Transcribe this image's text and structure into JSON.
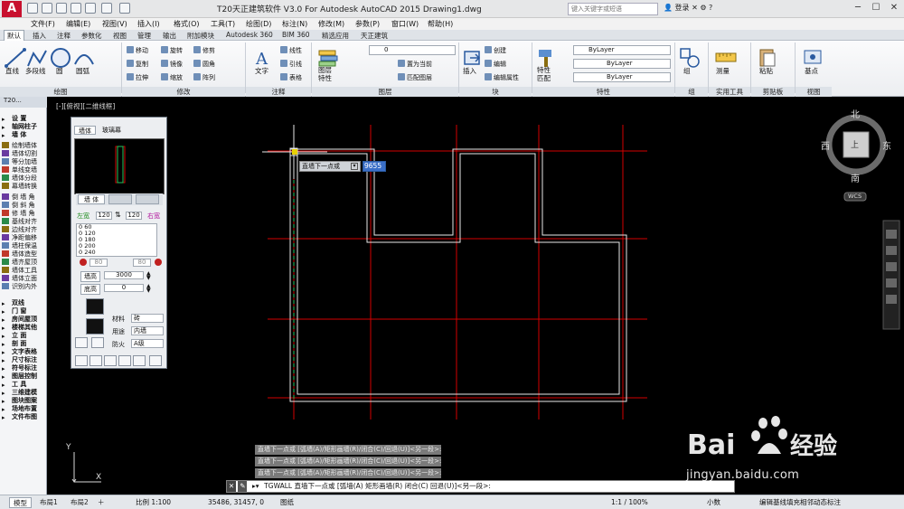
{
  "window": {
    "title": "T20天正建筑软件 V3.0 For Autodesk AutoCAD 2015        Drawing1.dwg",
    "search_placeholder": "键入关键字或短语",
    "login_label": "登录"
  },
  "menubar": [
    "文件(F)",
    "编辑(E)",
    "视图(V)",
    "插入(I)",
    "格式(O)",
    "工具(T)",
    "绘图(D)",
    "标注(N)",
    "修改(M)",
    "参数(P)",
    "窗口(W)",
    "帮助(H)"
  ],
  "ribbon_tabs": [
    "默认",
    "插入",
    "注释",
    "参数化",
    "视图",
    "管理",
    "输出",
    "附加模块",
    "Autodesk 360",
    "BIM 360",
    "精选应用",
    "天正建筑"
  ],
  "ribbon": {
    "draw": {
      "line": "直线",
      "polyline": "多段线",
      "circle": "圆",
      "arc": "圆弧",
      "panel": "绘图"
    },
    "modify": {
      "move": "移动",
      "rotate": "旋转",
      "trim": "修剪",
      "copy": "复制",
      "mirror": "镜像",
      "fillet": "圆角",
      "stretch": "拉伸",
      "scale": "缩放",
      "array": "阵列",
      "panel": "修改"
    },
    "annotation": {
      "text": "文字",
      "dim": "线性",
      "leader": "引线",
      "table": "表格",
      "panel": "注释"
    },
    "layers": {
      "props": "图层特性",
      "current_layer": "0",
      "make_current": "置为当前",
      "match": "匹配图层",
      "panel": "图层"
    },
    "block": {
      "insert": "插入",
      "create": "创建",
      "edit": "编辑",
      "edit_attr": "编辑属性",
      "panel": "块"
    },
    "properties": {
      "match": "特性匹配",
      "bylayer1": "ByLayer",
      "bylayer2": "ByLayer",
      "bylayer3": "ByLayer",
      "panel": "特性"
    },
    "groups": {
      "group": "组",
      "panel": "组"
    },
    "utilities": {
      "measure": "测量",
      "panel": "实用工具"
    },
    "clipboard": {
      "paste": "粘贴",
      "panel": "剪贴板"
    },
    "view": {
      "base": "基点",
      "panel": "视图"
    }
  },
  "palette": {
    "header": "T20...",
    "items": [
      "设 置",
      "轴网柱子",
      "墙 体",
      "绘制墙体",
      "墙体切割",
      "等分加墙",
      "单线变墙",
      "墙体分段",
      "幕墙转换",
      "倒 墙 角",
      "倒 斜 角",
      "修 墙 角",
      "基线对齐",
      "边线对齐",
      "净距偏移",
      "墙柱保温",
      "墙体造型",
      "墙齐屋顶",
      "墙体工具",
      "墙体立面",
      "识别内外",
      "双线",
      "门 窗",
      "房间屋顶",
      "楼梯其他",
      "立 面",
      "剖 面",
      "文字表格",
      "尺寸标注",
      "符号标注",
      "图层控制",
      "工 具",
      "三维建模",
      "图块图案",
      "场地布置",
      "文件布图"
    ]
  },
  "viewport_label": "[-][俯视][二维线框]",
  "dialog": {
    "tab_wall": "墙体",
    "tab_glass": "玻璃幕",
    "subtab_wall": "墙 体",
    "left_label": "左宽",
    "right_label": "右宽",
    "left_width": "120",
    "right_width": "120",
    "list_values": [
      "0      60",
      "0      120",
      "0      180",
      "0      200",
      "0      240"
    ],
    "left_offset": "80",
    "right_offset": "80",
    "height_label": "墙高",
    "height_value": "3000",
    "base_label": "底高",
    "base_value": "0",
    "material_label": "材料",
    "material_value": "砖",
    "usage_label": "用途",
    "usage_value": "内墙",
    "fire_label": "防火",
    "fire_value": "A级"
  },
  "prompt": {
    "label": "直墙下一点或",
    "value": "9655"
  },
  "compass": {
    "north": "北",
    "south": "南",
    "west": "西",
    "east": "东",
    "top": "上",
    "wcs": "WCS"
  },
  "ucs": {
    "x": "X",
    "y": "Y"
  },
  "command": {
    "history": [
      "直墙下一点或 [弧墙(A)/矩形画墙(R)/闭合(C)/回退(U)]<另一段>:",
      "直墙下一点或 [弧墙(A)/矩形画墙(R)/闭合(C)/回退(U)]<另一段>:",
      "直墙下一点或 [弧墙(A)/矩形画墙(R)/闭合(C)/回退(U)]<另一段>:"
    ],
    "current": "TGWALL 直墙下一点或 [弧墙(A) 矩形画墙(R) 闭合(C) 回退(U)]<另一段>:"
  },
  "status": {
    "tab_model": "模型",
    "tab_layout1": "布局1",
    "tab_layout2": "布局2",
    "scale": "比例 1:100",
    "coords": "35486, 31457, 0",
    "unit": "图纸",
    "zoom": "1:1 / 100%",
    "decimal": "小数",
    "hint": "编辑基线填充相邻动态标注"
  },
  "watermark": {
    "brand": "Bai",
    "brand2": "经验",
    "url": "jingyan.baidu.com"
  },
  "colors": {
    "background": "#000000",
    "axis": "#d40000",
    "wall": "#ffffff",
    "accent": "#c8102e"
  }
}
